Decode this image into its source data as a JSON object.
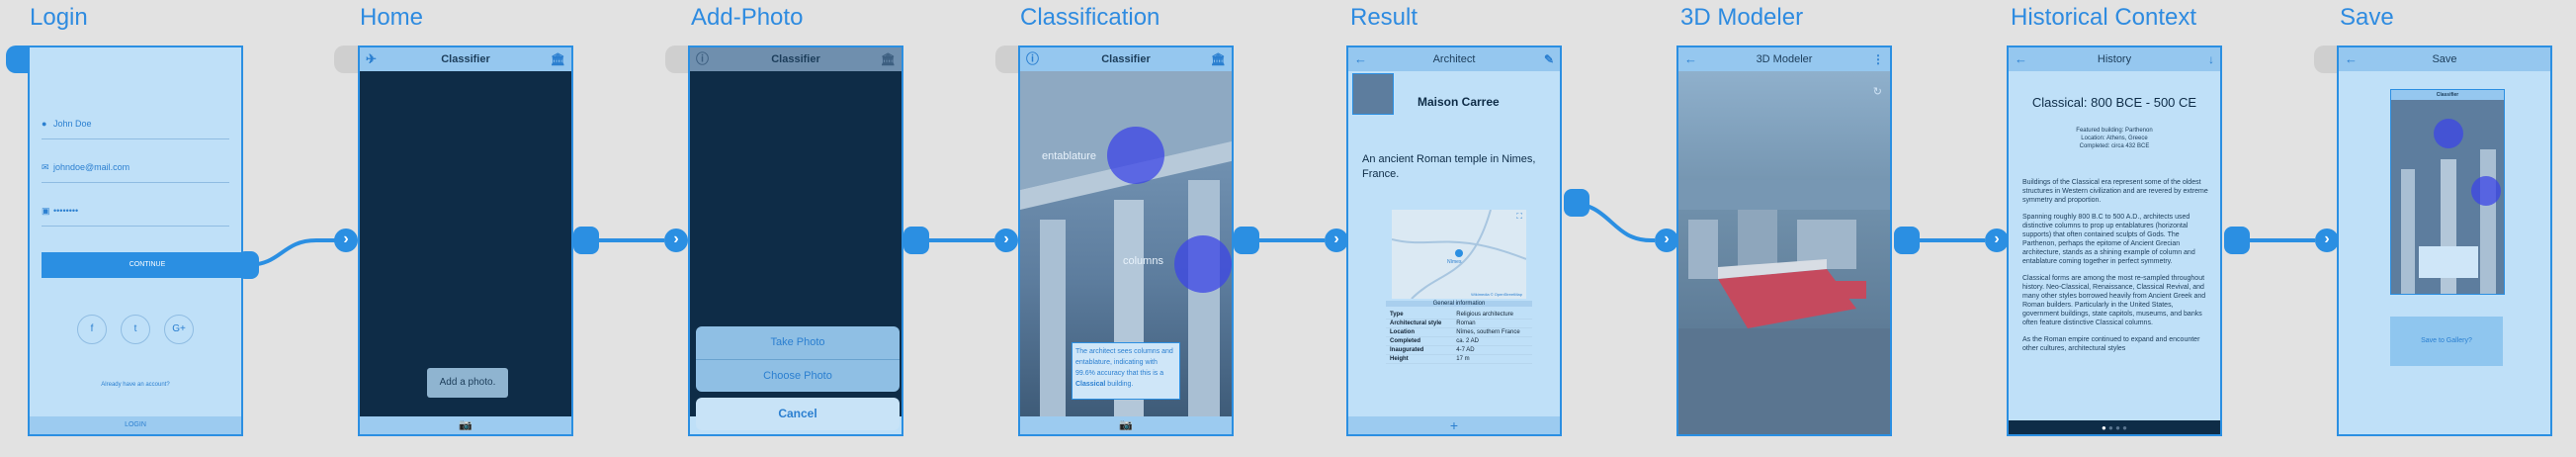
{
  "titles": [
    "Login",
    "Home",
    "Add-Photo",
    "Classification",
    "Result",
    "3D Modeler",
    "Historical Context",
    "Save"
  ],
  "login": {
    "name": "John Doe",
    "email": "johndoe@mail.com",
    "password": "••••••••",
    "continue": "CONTINUE",
    "social": [
      "f",
      "t",
      "G+"
    ],
    "already": "Already have an account?",
    "login": "LOGIN"
  },
  "home": {
    "title": "Classifier",
    "toast": "Add a photo."
  },
  "addphoto": {
    "title": "Classifier",
    "take": "Take Photo",
    "choose": "Choose Photo",
    "cancel": "Cancel"
  },
  "classification": {
    "title": "Classifier",
    "label1": "entablature",
    "label2": "columns",
    "msg_a": "The architect sees columns and entablature, indicating with 99.6% accuracy that this is a ",
    "msg_b": "Classical",
    "msg_c": " building."
  },
  "result": {
    "title": "Architect",
    "name": "Maison Carree",
    "desc": "An ancient Roman temple in Nimes, France.",
    "info_header": "General information",
    "info": [
      [
        "Type",
        "Religious architecture"
      ],
      [
        "Architectural style",
        "Roman"
      ],
      [
        "Location",
        "Nîmes, southern France"
      ],
      [
        "Completed",
        "ca. 2 AD"
      ],
      [
        "Inaugurated",
        "4-7 AD"
      ],
      [
        "Height",
        "17 m"
      ]
    ],
    "map_label": "Nîmes",
    "map_credit": "Wikimedia © OpenStreetMap",
    "plus": "+"
  },
  "modeler": {
    "title": "3D Modeler"
  },
  "history": {
    "title": "History",
    "heading": "Classical: 800 BCE - 500 CE",
    "featured1": "Featured building: Parthenon",
    "featured2": "Location: Athens, Greece",
    "featured3": "Completed: circa 432 BCE",
    "p1": "Buildings of the Classical era represent some of the oldest structures in Western civilization and are revered by extreme symmetry and proportion.",
    "p2": "Spanning roughly 800 B.C to 500 A.D., architects used distinctive columns to prop up entablatures (horizontal supports) that often contained sculpts of Gods. The Parthenon, perhaps the epitome of Ancient Grecian architecture, stands as a shining example of column and entablature coming together in perfect symmetry.",
    "p3": "Classical forms are among the most re-sampled throughout history. Neo-Classical, Renaissance, Classical Revival, and many other styles borrowed heavily from Ancient Greek and Roman builders. Particularly in the United States, government buildings, state capitols, museums, and banks often feature distinctive Classical columns.",
    "p4": "As the Roman empire continued to expand and encounter other cultures, architectural styles"
  },
  "save": {
    "title": "Save",
    "inner_title": "Classifier",
    "button": "Save to Gallery?"
  }
}
